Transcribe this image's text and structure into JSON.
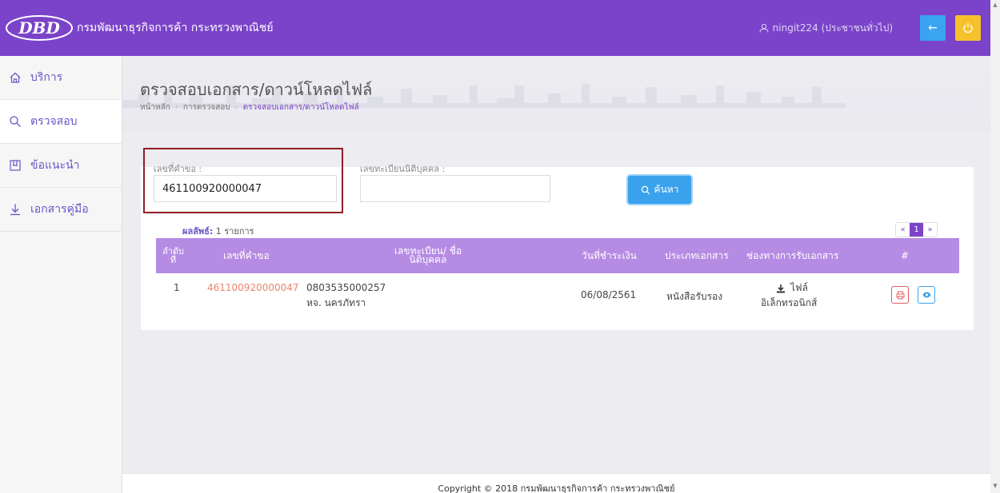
{
  "header": {
    "logo_text": "DBD",
    "title": "กรมพัฒนาธุรกิจการค้า กระทรวงพาณิชย์",
    "user": "ningit224 (ประชาชนทั่วไป)"
  },
  "sidebar": {
    "items": [
      {
        "label": "บริการ",
        "icon": "home-icon"
      },
      {
        "label": "ตรวจสอบ",
        "icon": "search-icon"
      },
      {
        "label": "ข้อแนะนำ",
        "icon": "guide-icon"
      },
      {
        "label": "เอกสารคู่มือ",
        "icon": "download-icon"
      }
    ]
  },
  "page": {
    "title": "ตรวจสอบเอกสาร/ดาวน์โหลดไฟล์",
    "breadcrumb": [
      "หน้าหลัก",
      "การตรวจสอบ",
      "ตรวจสอบเอกสาร/ดาวน์โหลดไฟล์"
    ]
  },
  "form": {
    "request_label": "เลขที่คำขอ :",
    "request_value": "461100920000047",
    "juristic_label": "เลขทะเบียนนิติบุคคล :",
    "juristic_value": "",
    "search_label": "ค้นหา"
  },
  "results": {
    "label": "ผลลัพธ์:",
    "count_text": "1 รายการ",
    "pager": [
      "«",
      "1",
      "»"
    ]
  },
  "table": {
    "headers": {
      "no": "ลำดับที่",
      "request_no": "เลขที่คำขอ",
      "juristic": "เลขทะเบียน/ ชื่อนิติบุคคล",
      "pay_date": "วันที่ชำระเงิน",
      "doc_type": "ประเภทเอกสาร",
      "channel": "ช่องทางการรับเอกสาร",
      "action": "#"
    },
    "rows": [
      {
        "no": "1",
        "request_no": "461100920000047",
        "juristic_id": "0803535000257",
        "juristic_name": "หจ. นครภัทรา",
        "pay_date": "06/08/2561",
        "doc_type": "หนังสือรับรอง",
        "channel_line1": "ไฟล์",
        "channel_line2": "อิเล็กทรอนิกส์"
      }
    ]
  },
  "footer": {
    "copyright": "Copyright © 2018 กรมพัฒนาธุรกิจการค้า กระทรวงพาณิชย์"
  },
  "colors": {
    "header": "#7b43c9",
    "table_header": "#b58be3",
    "accent_blue": "#3aa2ec",
    "accent_yellow": "#f6c12b",
    "link": "#e9856a"
  }
}
